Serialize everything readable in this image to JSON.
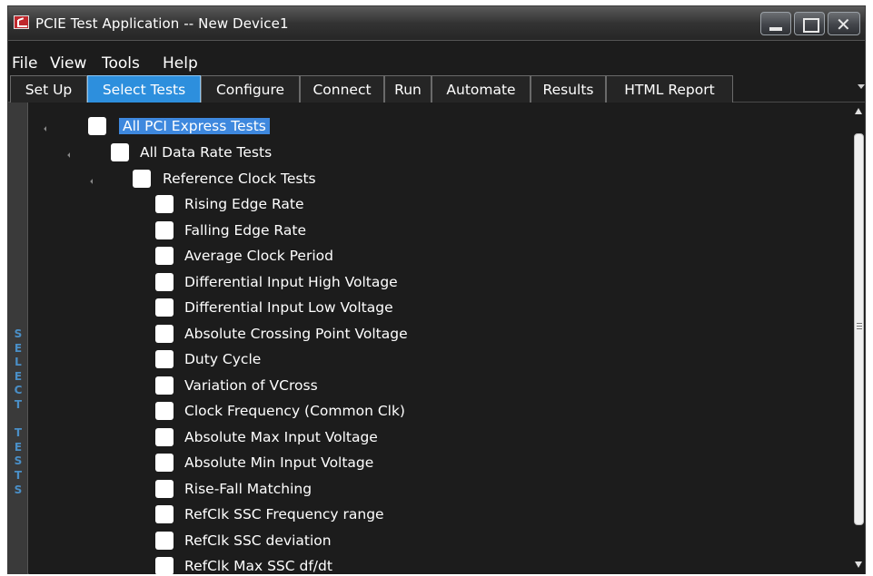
{
  "window": {
    "title": "PCIE Test Application -- New Device1"
  },
  "menu": {
    "items": [
      "File",
      "View",
      "Tools",
      "Help"
    ]
  },
  "tabs": {
    "items": [
      "Set Up",
      "Select Tests",
      "Configure",
      "Connect",
      "Run",
      "Automate",
      "Results",
      "HTML Report"
    ],
    "active": "Select Tests"
  },
  "side_label": "SELECT TESTS",
  "tree": {
    "root": "All PCI Express Tests",
    "group": "All Data Rate Tests",
    "subgroup": "Reference Clock Tests",
    "tests": [
      "Rising Edge Rate",
      "Falling Edge Rate",
      "Average Clock Period",
      "Differential Input High Voltage",
      "Differential Input Low Voltage",
      "Absolute Crossing Point Voltage",
      "Duty Cycle",
      "Variation of VCross",
      "Clock Frequency (Common Clk)",
      "Absolute Max Input Voltage",
      "Absolute Min Input Voltage",
      "Rise-Fall Matching",
      "RefClk SSC Frequency range",
      "RefClk SSC deviation",
      "RefClk Max SSC df/dt"
    ]
  },
  "colors": {
    "background": "#1c1c1c",
    "active_tab": "#2d8fdd",
    "selection": "#3e88de",
    "side_label": "#4a8fc7"
  },
  "icons": {
    "app": "app-icon",
    "minimize": "minimize-icon",
    "maximize": "maximize-icon",
    "close": "close-icon",
    "expander": "tree-expander-icon",
    "tab_overflow": "chevron-down-icon"
  }
}
